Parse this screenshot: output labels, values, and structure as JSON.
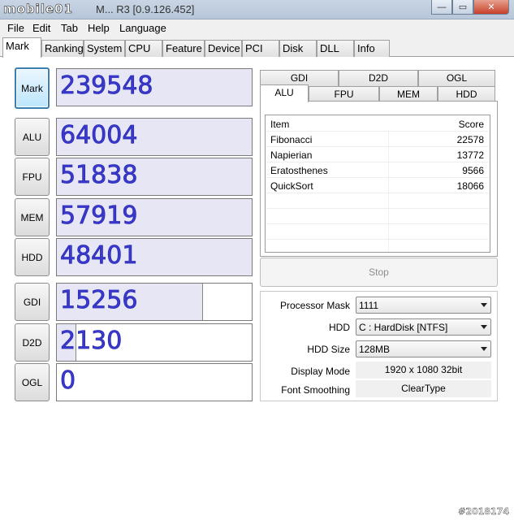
{
  "window": {
    "logo_text": "mobile01",
    "title_suffix": "M... R3 [0.9.126.452]",
    "minimize_glyph": "—",
    "maximize_glyph": "▭",
    "close_glyph": "✕"
  },
  "menu": [
    "File",
    "Edit",
    "Tab",
    "Help",
    "Language"
  ],
  "tabs": [
    "Mark",
    "Ranking",
    "System",
    "CPU",
    "Feature",
    "Device",
    "PCI",
    "Disk",
    "DLL",
    "Info"
  ],
  "active_tab": "Mark",
  "scores": {
    "mark": {
      "label": "Mark",
      "value": "239548"
    },
    "alu": {
      "label": "ALU",
      "value": "64004"
    },
    "fpu": {
      "label": "FPU",
      "value": "51838"
    },
    "mem": {
      "label": "MEM",
      "value": "57919"
    },
    "hdd": {
      "label": "HDD",
      "value": "48401"
    },
    "gdi": {
      "label": "GDI",
      "value": "15256",
      "fill_fraction": 0.75
    },
    "d2d": {
      "label": "D2D",
      "value": "2130",
      "fill_fraction": 0.1
    },
    "ogl": {
      "label": "OGL",
      "value": "0",
      "fill_fraction": 0.0
    }
  },
  "right_tabs_row1": [
    "GDI",
    "D2D",
    "OGL"
  ],
  "right_tabs_row2": [
    "ALU",
    "FPU",
    "MEM",
    "HDD"
  ],
  "active_right_tab": "ALU",
  "list": {
    "columns": [
      "Item",
      "Score"
    ],
    "rows": [
      {
        "item": "Fibonacci",
        "score": "22578"
      },
      {
        "item": "Napierian",
        "score": "13772"
      },
      {
        "item": "Eratosthenes",
        "score": "9566"
      },
      {
        "item": "QuickSort",
        "score": "18066"
      }
    ]
  },
  "stop_label": "Stop",
  "options": {
    "processor_mask": {
      "label": "Processor Mask",
      "value": "1111"
    },
    "hdd": {
      "label": "HDD",
      "value": "C : HardDisk [NTFS]"
    },
    "hdd_size": {
      "label": "HDD Size",
      "value": "128MB"
    },
    "display_mode": {
      "label": "Display Mode",
      "value": "1920 x 1080 32bit"
    },
    "font_smoothing": {
      "label": "Font Smoothing",
      "value": "ClearType"
    }
  },
  "watermark": "#2018174"
}
